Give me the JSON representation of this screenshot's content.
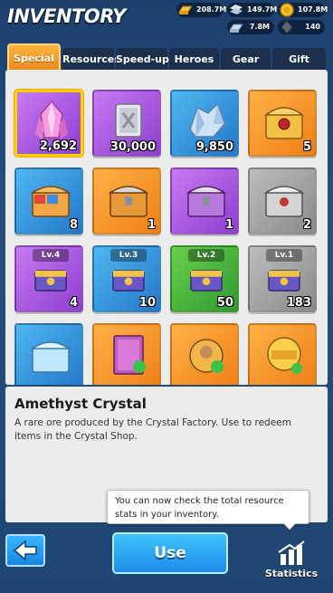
{
  "header": {
    "title": "INVENTORY",
    "resources": [
      {
        "icon": "gold-bar-icon",
        "value": "208.7M"
      },
      {
        "icon": "steel-icon",
        "value": "149.7M"
      },
      {
        "icon": "coin-icon",
        "value": "107.8M"
      },
      {
        "icon": "silver-ingot-icon",
        "value": "7.8M"
      },
      {
        "icon": "dark-crystal-icon",
        "value": "140"
      }
    ]
  },
  "tabs": [
    {
      "label": "Special",
      "active": true
    },
    {
      "label": "Resources"
    },
    {
      "label": "Speed-up"
    },
    {
      "label": "Heroes"
    },
    {
      "label": "Gear"
    },
    {
      "label": "Gift"
    }
  ],
  "items": [
    {
      "name": "amethyst-crystal",
      "qty": "2,692",
      "color": "purple",
      "icon": "crystal-icon"
    },
    {
      "name": "silver-block",
      "qty": "30,000",
      "color": "purple",
      "icon": "metal-block-icon"
    },
    {
      "name": "blue-ore",
      "qty": "9,850",
      "color": "blue",
      "icon": "ore-icon"
    },
    {
      "name": "golden-chest",
      "qty": "5",
      "color": "orange",
      "icon": "chest-icon"
    },
    {
      "name": "booster-chest",
      "qty": "8",
      "color": "blue",
      "icon": "chest-icon"
    },
    {
      "name": "orange-chest",
      "qty": "1",
      "color": "orange",
      "icon": "chest-icon"
    },
    {
      "name": "purple-chest",
      "qty": "1",
      "color": "purple",
      "icon": "chest-icon"
    },
    {
      "name": "grey-chest",
      "qty": "2",
      "color": "grey",
      "icon": "chest-icon"
    },
    {
      "name": "lv4-chest",
      "qty": "4",
      "color": "purple",
      "icon": "chest-icon",
      "level": "Lv.4"
    },
    {
      "name": "lv3-chest",
      "qty": "10",
      "color": "blue",
      "icon": "chest-icon",
      "level": "Lv.3"
    },
    {
      "name": "lv2-chest",
      "qty": "50",
      "color": "green",
      "icon": "chest-icon",
      "level": "Lv.2"
    },
    {
      "name": "lv1-chest",
      "qty": "183",
      "color": "grey",
      "icon": "chest-icon",
      "level": "Lv.1"
    },
    {
      "name": "ice-chest",
      "qty": "",
      "color": "blue",
      "icon": "chest-icon"
    },
    {
      "name": "skill-book",
      "qty": "",
      "color": "orange",
      "icon": "book-icon"
    },
    {
      "name": "hero-token",
      "qty": "",
      "color": "orange",
      "icon": "hero-icon"
    },
    {
      "name": "skill-medal",
      "qty": "",
      "color": "orange",
      "icon": "medal-icon"
    }
  ],
  "selected": {
    "name": "Amethyst Crystal",
    "description": "A rare ore produced by the Crystal Factory. Use to redeem items in the Crystal Shop."
  },
  "tooltip": "You can now check the total resource stats in your inventory.",
  "buttons": {
    "use": "Use",
    "statistics": "Statistics"
  },
  "colors": {
    "accent": "#f39321",
    "primary_button": "#2a9ef0",
    "background": "#234a78"
  }
}
